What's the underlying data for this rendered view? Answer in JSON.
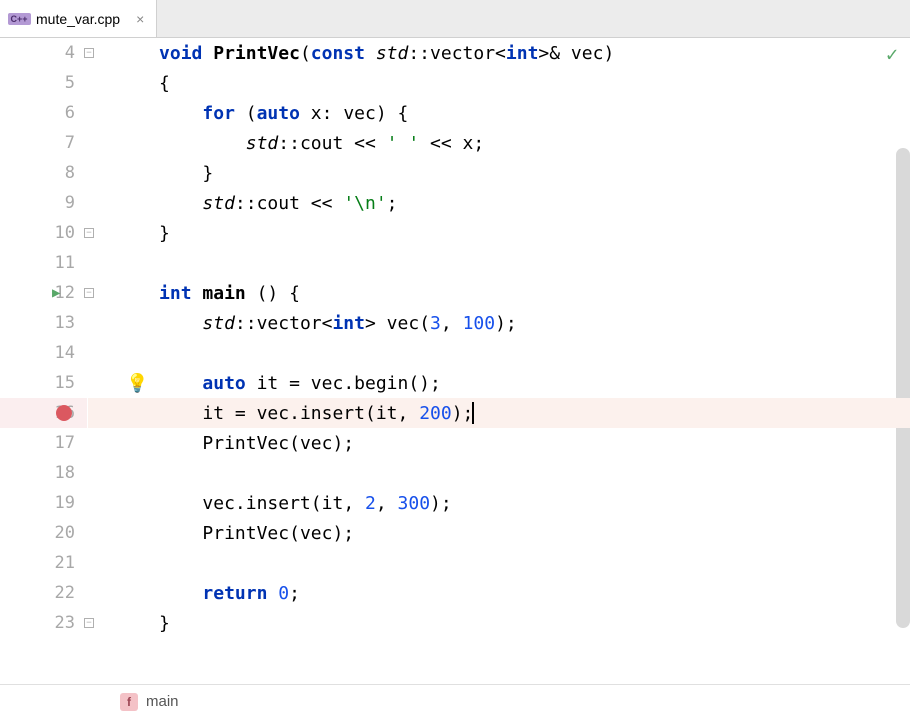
{
  "tab": {
    "icon_text": "C++",
    "filename": "mute_var.cpp",
    "close": "×"
  },
  "gutter": {
    "line_numbers": [
      "4",
      "5",
      "6",
      "7",
      "8",
      "9",
      "10",
      "11",
      "12",
      "13",
      "14",
      "15",
      "16",
      "17",
      "18",
      "19",
      "20",
      "21",
      "22",
      "23"
    ],
    "run_line": 12,
    "breakpoint_line": 16,
    "bulb_line": 15
  },
  "code": {
    "lines": [
      {
        "n": 4,
        "fold": "open",
        "tokens": [
          {
            "t": "kw",
            "v": "void"
          },
          {
            "t": "sp",
            "v": " "
          },
          {
            "t": "fn",
            "v": "PrintVec"
          },
          {
            "t": "pn",
            "v": "("
          },
          {
            "t": "kw",
            "v": "const"
          },
          {
            "t": "sp",
            "v": " "
          },
          {
            "t": "ns",
            "v": "std"
          },
          {
            "t": "op",
            "v": "::"
          },
          {
            "t": "ty",
            "v": "vector"
          },
          {
            "t": "op",
            "v": "<"
          },
          {
            "t": "kw",
            "v": "int"
          },
          {
            "t": "op",
            "v": ">& "
          },
          {
            "t": "vname",
            "v": "vec"
          },
          {
            "t": "pn",
            "v": ")"
          }
        ]
      },
      {
        "n": 5,
        "tokens": [
          {
            "t": "pn",
            "v": "{"
          }
        ]
      },
      {
        "n": 6,
        "tokens": [
          {
            "t": "sp",
            "v": "    "
          },
          {
            "t": "kw",
            "v": "for"
          },
          {
            "t": "sp",
            "v": " "
          },
          {
            "t": "pn",
            "v": "("
          },
          {
            "t": "kw",
            "v": "auto"
          },
          {
            "t": "sp",
            "v": " "
          },
          {
            "t": "vname",
            "v": "x"
          },
          {
            "t": "op",
            "v": ": "
          },
          {
            "t": "vname",
            "v": "vec"
          },
          {
            "t": "pn",
            "v": ") {"
          }
        ]
      },
      {
        "n": 7,
        "tokens": [
          {
            "t": "sp",
            "v": "        "
          },
          {
            "t": "ns",
            "v": "std"
          },
          {
            "t": "op",
            "v": "::"
          },
          {
            "t": "vname",
            "v": "cout"
          },
          {
            "t": "op",
            "v": " << "
          },
          {
            "t": "str",
            "v": "' '"
          },
          {
            "t": "op",
            "v": " << "
          },
          {
            "t": "vname",
            "v": "x"
          },
          {
            "t": "pn",
            "v": ";"
          }
        ]
      },
      {
        "n": 8,
        "tokens": [
          {
            "t": "sp",
            "v": "    "
          },
          {
            "t": "pn",
            "v": "}"
          }
        ]
      },
      {
        "n": 9,
        "tokens": [
          {
            "t": "sp",
            "v": "    "
          },
          {
            "t": "ns",
            "v": "std"
          },
          {
            "t": "op",
            "v": "::"
          },
          {
            "t": "vname",
            "v": "cout"
          },
          {
            "t": "op",
            "v": " << "
          },
          {
            "t": "str",
            "v": "'\\n'"
          },
          {
            "t": "pn",
            "v": ";"
          }
        ]
      },
      {
        "n": 10,
        "fold": "close",
        "tokens": [
          {
            "t": "pn",
            "v": "}"
          }
        ]
      },
      {
        "n": 11,
        "tokens": []
      },
      {
        "n": 12,
        "fold": "open",
        "tokens": [
          {
            "t": "kw",
            "v": "int"
          },
          {
            "t": "sp",
            "v": " "
          },
          {
            "t": "fn",
            "v": "main"
          },
          {
            "t": "sp",
            "v": " "
          },
          {
            "t": "pn",
            "v": "() {"
          }
        ]
      },
      {
        "n": 13,
        "tokens": [
          {
            "t": "sp",
            "v": "    "
          },
          {
            "t": "ns",
            "v": "std"
          },
          {
            "t": "op",
            "v": "::"
          },
          {
            "t": "ty",
            "v": "vector"
          },
          {
            "t": "op",
            "v": "<"
          },
          {
            "t": "kw",
            "v": "int"
          },
          {
            "t": "op",
            "v": "> "
          },
          {
            "t": "vname",
            "v": "vec"
          },
          {
            "t": "pn",
            "v": "("
          },
          {
            "t": "num",
            "v": "3"
          },
          {
            "t": "pn",
            "v": ", "
          },
          {
            "t": "num",
            "v": "100"
          },
          {
            "t": "pn",
            "v": ");"
          }
        ]
      },
      {
        "n": 14,
        "tokens": []
      },
      {
        "n": 15,
        "tokens": [
          {
            "t": "sp",
            "v": "    "
          },
          {
            "t": "kw",
            "v": "auto"
          },
          {
            "t": "sp",
            "v": " "
          },
          {
            "t": "vname",
            "v": "it"
          },
          {
            "t": "op",
            "v": " = "
          },
          {
            "t": "vname",
            "v": "vec"
          },
          {
            "t": "op",
            "v": "."
          },
          {
            "t": "vname",
            "v": "begin"
          },
          {
            "t": "pn",
            "v": "();"
          }
        ]
      },
      {
        "n": 16,
        "highlight": true,
        "cursor": true,
        "tokens": [
          {
            "t": "sp",
            "v": "    "
          },
          {
            "t": "vname",
            "v": "it"
          },
          {
            "t": "op",
            "v": " = "
          },
          {
            "t": "vname",
            "v": "vec"
          },
          {
            "t": "op",
            "v": "."
          },
          {
            "t": "vname",
            "v": "insert"
          },
          {
            "t": "pn",
            "v": "("
          },
          {
            "t": "vname",
            "v": "it"
          },
          {
            "t": "pn",
            "v": ", "
          },
          {
            "t": "num",
            "v": "200"
          },
          {
            "t": "pn",
            "v": ");"
          }
        ]
      },
      {
        "n": 17,
        "tokens": [
          {
            "t": "sp",
            "v": "    "
          },
          {
            "t": "vname",
            "v": "PrintVec"
          },
          {
            "t": "pn",
            "v": "("
          },
          {
            "t": "vname",
            "v": "vec"
          },
          {
            "t": "pn",
            "v": ");"
          }
        ]
      },
      {
        "n": 18,
        "tokens": []
      },
      {
        "n": 19,
        "tokens": [
          {
            "t": "sp",
            "v": "    "
          },
          {
            "t": "vname",
            "v": "vec"
          },
          {
            "t": "op",
            "v": "."
          },
          {
            "t": "vname",
            "v": "insert"
          },
          {
            "t": "pn",
            "v": "("
          },
          {
            "t": "vname",
            "v": "it"
          },
          {
            "t": "pn",
            "v": ", "
          },
          {
            "t": "num",
            "v": "2"
          },
          {
            "t": "pn",
            "v": ", "
          },
          {
            "t": "num",
            "v": "300"
          },
          {
            "t": "pn",
            "v": ");"
          }
        ]
      },
      {
        "n": 20,
        "tokens": [
          {
            "t": "sp",
            "v": "    "
          },
          {
            "t": "vname",
            "v": "PrintVec"
          },
          {
            "t": "pn",
            "v": "("
          },
          {
            "t": "vname",
            "v": "vec"
          },
          {
            "t": "pn",
            "v": ");"
          }
        ]
      },
      {
        "n": 21,
        "tokens": []
      },
      {
        "n": 22,
        "tokens": [
          {
            "t": "sp",
            "v": "    "
          },
          {
            "t": "kw",
            "v": "return"
          },
          {
            "t": "sp",
            "v": " "
          },
          {
            "t": "num",
            "v": "0"
          },
          {
            "t": "pn",
            "v": ";"
          }
        ]
      },
      {
        "n": 23,
        "fold": "close",
        "tokens": [
          {
            "t": "pn",
            "v": "}"
          }
        ]
      }
    ]
  },
  "breadcrumb": {
    "icon": "f",
    "label": "main"
  },
  "status": {
    "ok_check": "✓"
  },
  "colors": {
    "keyword": "#0033b3",
    "string": "#067d17",
    "number": "#1750eb",
    "breakpoint_bg": "#fcf1ed",
    "breakpoint_dot": "#db5860",
    "run_green": "#59a869"
  }
}
